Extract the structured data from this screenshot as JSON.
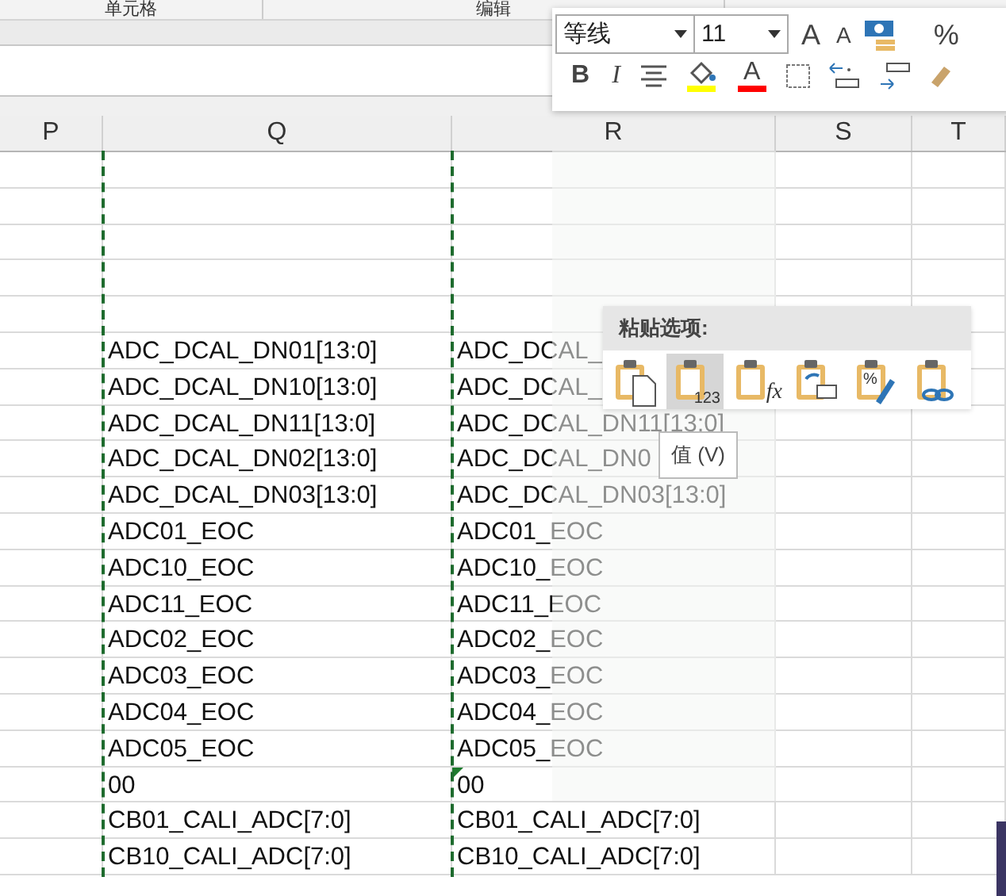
{
  "ribbon": {
    "groups": [
      "单元格",
      "编辑"
    ]
  },
  "mini_toolbar": {
    "font": "等线",
    "size": "11",
    "bold": "B",
    "italic": "I",
    "font_color": "A",
    "grow": "A",
    "shrink": "A",
    "percent": "%"
  },
  "columns": [
    {
      "label": "P"
    },
    {
      "label": "Q"
    },
    {
      "label": "R"
    },
    {
      "label": "S"
    },
    {
      "label": "T"
    }
  ],
  "rows": [
    {
      "q": "ADC_DCAL_DN01[13:0]",
      "r": "ADC_DCAL_",
      "error_mark": false
    },
    {
      "q": "ADC_DCAL_DN10[13:0]",
      "r": "ADC_DCAL_",
      "error_mark": false
    },
    {
      "q": "ADC_DCAL_DN11[13:0]",
      "r": "ADC_DCAL_DN11[13:0]",
      "error_mark": false
    },
    {
      "q": "ADC_DCAL_DN02[13:0]",
      "r": "ADC_DCAL_DN0",
      "error_mark": false
    },
    {
      "q": "ADC_DCAL_DN03[13:0]",
      "r": "ADC_DCAL_DN03[13:0]",
      "error_mark": false
    },
    {
      "q": "ADC01_EOC",
      "r": "ADC01_EOC",
      "error_mark": false
    },
    {
      "q": "ADC10_EOC",
      "r": "ADC10_EOC",
      "error_mark": false
    },
    {
      "q": "ADC11_EOC",
      "r": "ADC11_EOC",
      "error_mark": false
    },
    {
      "q": "ADC02_EOC",
      "r": "ADC02_EOC",
      "error_mark": false
    },
    {
      "q": "ADC03_EOC",
      "r": "ADC03_EOC",
      "error_mark": false
    },
    {
      "q": "ADC04_EOC",
      "r": "ADC04_EOC",
      "error_mark": false
    },
    {
      "q": "ADC05_EOC",
      "r": "ADC05_EOC",
      "error_mark": false
    },
    {
      "q": "00",
      "r": "00",
      "error_mark": true
    },
    {
      "q": "CB01_CALI_ADC[7:0]",
      "r": "CB01_CALI_ADC[7:0]",
      "error_mark": false
    },
    {
      "q": "CB10_CALI_ADC[7:0]",
      "r": "CB10_CALI_ADC[7:0]",
      "error_mark": false
    }
  ],
  "paste_options": {
    "title": "粘贴选项:",
    "tooltip": "值 (V)",
    "items": [
      {
        "kind": "paste",
        "selected": false
      },
      {
        "kind": "values",
        "selected": true,
        "label": "123"
      },
      {
        "kind": "formulas",
        "selected": false,
        "label": "fx"
      },
      {
        "kind": "transpose",
        "selected": false
      },
      {
        "kind": "formatting",
        "selected": false,
        "label": "%"
      },
      {
        "kind": "link",
        "selected": false
      }
    ]
  }
}
